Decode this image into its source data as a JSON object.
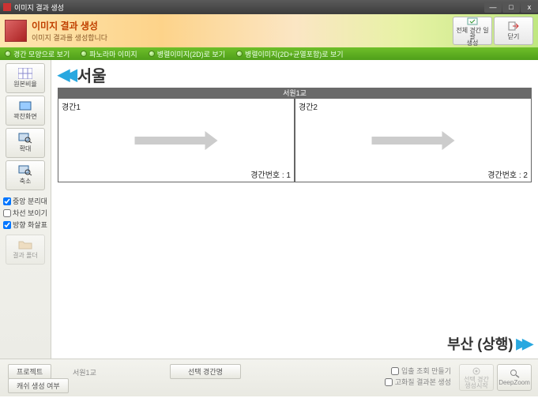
{
  "window": {
    "title": "이미지 결과 생성"
  },
  "header": {
    "title": "이미지 결과 생성",
    "subtitle": "이미지 결과를 생성합니다",
    "btn_batch": "전체 경간 일괄\n생성",
    "btn_close": "닫기"
  },
  "greentabs": {
    "t1": "경간 모양으로 보기",
    "t2": "파노라마 이미지",
    "t3": "병렬이미지(2D)로 보기",
    "t4": "병렬이미지(2D+균열포함)로 보기"
  },
  "sidebar": {
    "items": [
      "원본비율",
      "꽉찬화면",
      "확대",
      "축소"
    ],
    "checks": {
      "c1": "중앙 분리대",
      "c2": "차선 보이기",
      "c3": "방향 화살표"
    },
    "folder": "결과 폴더"
  },
  "content": {
    "top_dir": "서울",
    "bridge": "서원1교",
    "panels": [
      {
        "label": "경간1",
        "num": "경간번호 : 1"
      },
      {
        "label": "경간2",
        "num": "경간번호 : 2"
      }
    ],
    "bottom_dir": "부산 (상행)"
  },
  "footer": {
    "tab_project": "프로젝트",
    "tab_cache": "캐쉬 생성 여부",
    "bridge_name": "서원1교",
    "sel_span": "선택 경간명",
    "cb1": "입출 조회 만들기",
    "cb2": "고화질 결과본 생성",
    "btn_start": "선택 경간\n생성시작",
    "btn_deep": "DeepZoom"
  }
}
